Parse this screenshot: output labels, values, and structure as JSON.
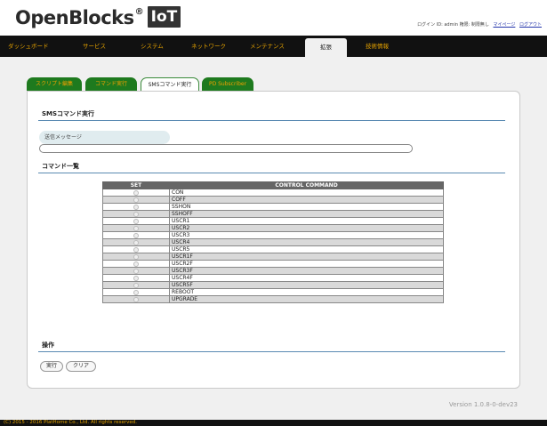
{
  "header": {
    "logo_text": "OpenBlocks",
    "logo_reg": "®",
    "logo_badge": "IoT",
    "login_text": "ログイン ID: admin 権限: 制限無し",
    "mypage_link": "マイページ",
    "logout_link": "ログアウト"
  },
  "nav": {
    "items": [
      {
        "label": "ダッシュボード"
      },
      {
        "label": "サービス"
      },
      {
        "label": "システム"
      },
      {
        "label": "ネットワーク"
      },
      {
        "label": "メンテナンス"
      },
      {
        "label": "拡張"
      },
      {
        "label": "技術情報"
      }
    ],
    "active_index": 5
  },
  "subtabs": [
    {
      "label": "スクリプト編集"
    },
    {
      "label": "コマンド実行"
    },
    {
      "label": "SMSコマンド実行"
    },
    {
      "label": "PD Subscriber"
    }
  ],
  "panel": {
    "section1_title": "SMSコマンド実行",
    "field_label": "送信メッセージ",
    "message_value": "",
    "section2_title": "コマンド一覧",
    "table": {
      "headers": [
        "SET",
        "CONTROL COMMAND"
      ],
      "rows": [
        "CON",
        "COFF",
        "SSHON",
        "SSHOFF",
        "USCR1",
        "USCR2",
        "USCR3",
        "USCR4",
        "USCR5",
        "USCR1F",
        "USCR2F",
        "USCR3F",
        "USCR4F",
        "USCR5F",
        "REBOOT",
        "UPGRADE"
      ]
    },
    "section3_title": "操作",
    "execute_label": "実行",
    "clear_label": "クリア"
  },
  "version": "Version 1.0.8-0-dev23",
  "footer": "(C) 2015 - 2016 PlatHome Co., Ltd. All rights reserved.",
  "colors": {
    "nav_bg": "#111111",
    "nav_text": "#e2a000",
    "subtab_bg": "#1e7a1e",
    "section_line": "#5a8ab2"
  }
}
